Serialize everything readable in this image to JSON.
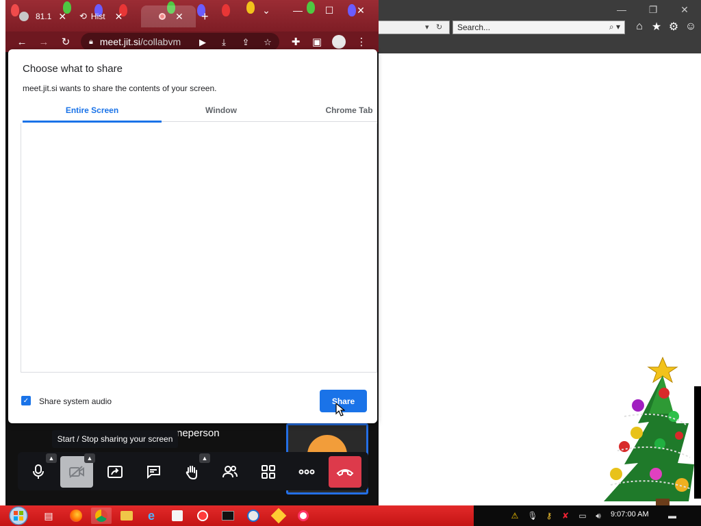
{
  "chrome": {
    "tabs": [
      {
        "label": "81.1",
        "close": "✕"
      },
      {
        "label": "Hist",
        "close": "✕"
      },
      {
        "label": "",
        "close": "✕"
      }
    ],
    "new_tab": "+",
    "url_host": "meet.jit.si",
    "url_path": "/collabvm"
  },
  "ie": {
    "search_placeholder": "Search..."
  },
  "dialog": {
    "title": "Choose what to share",
    "subtitle": "meet.jit.si wants to share the contents of your screen.",
    "tabs": [
      {
        "label": "Entire Screen",
        "active": true
      },
      {
        "label": "Window",
        "active": false
      },
      {
        "label": "Chrome Tab",
        "active": false
      }
    ],
    "share_audio_label": "Share system audio",
    "share_audio_checked": true,
    "share_button": "Share"
  },
  "meeting": {
    "participant_name_fragment": "neperson",
    "tooltip": "Start / Stop sharing your screen",
    "toolbar_icons": [
      "microphone-icon",
      "camera-off-icon",
      "screen-share-icon",
      "chat-icon",
      "raise-hand-icon",
      "participants-icon",
      "tile-view-icon",
      "more-icon",
      "hangup-icon"
    ]
  },
  "taskbar": {
    "clock": "9:07:00 AM"
  },
  "colors": {
    "accent": "#1a73e8",
    "hangup": "#dd3a4b",
    "taskbar": "#d21f1f",
    "chrome_frame": "#8b2430"
  }
}
